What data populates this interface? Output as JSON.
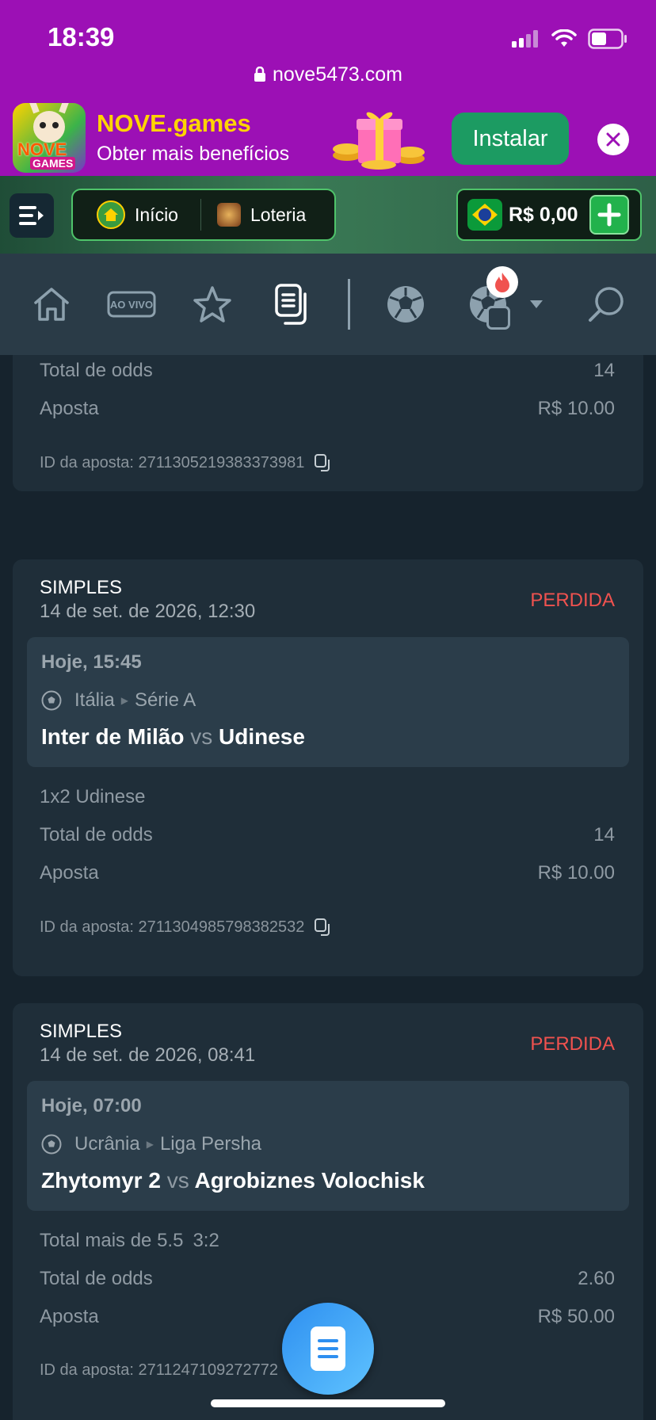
{
  "status_bar": {
    "time": "18:39",
    "url": "nove5473.com"
  },
  "install_banner": {
    "icon_text_1": "NOVE",
    "icon_text_2": "GAMES",
    "title": "NOVE.games",
    "subtitle": "Obter mais benefícios",
    "install_label": "Instalar"
  },
  "top_nav": {
    "home_label": "Início",
    "lottery_label": "Loteria",
    "balance": "R$ 0,00"
  },
  "tabs": {
    "live_label": "AO VIVO"
  },
  "bets": [
    {
      "odds_label": "Total de odds",
      "odds": "14",
      "stake_label": "Aposta",
      "stake": "R$ 10.00",
      "id_label": "ID da aposta: 2711305219383373981"
    },
    {
      "type": "SIMPLES",
      "date": "14 de set. de 2026, 12:30",
      "status": "PERDIDA",
      "event_time": "Hoje, 15:45",
      "country": "Itália",
      "league": "Série A",
      "home": "Inter de Milão",
      "vs": "vs",
      "away": "Udinese",
      "market": "1x2 Udinese",
      "odds_label": "Total de odds",
      "odds": "14",
      "stake_label": "Aposta",
      "stake": "R$ 10.00",
      "id_label": "ID da aposta: 2711304985798382532"
    },
    {
      "type": "SIMPLES",
      "date": "14 de set. de 2026, 08:41",
      "status": "PERDIDA",
      "event_time": "Hoje, 07:00",
      "country": "Ucrânia",
      "league": "Liga Persha",
      "home": "Zhytomyr 2",
      "vs": "vs",
      "away": "Agrobiznes Volochisk",
      "market": "Total mais de 5.5",
      "score": "3:2",
      "odds_label": "Total de odds",
      "odds": "2.60",
      "stake_label": "Aposta",
      "stake": "R$ 50.00",
      "id_label": "ID da aposta: 2711247109272772"
    }
  ],
  "colors": {
    "status_lost": "#f0524f",
    "brand_purple": "#9c10b5",
    "accent_green": "#22b24c"
  }
}
